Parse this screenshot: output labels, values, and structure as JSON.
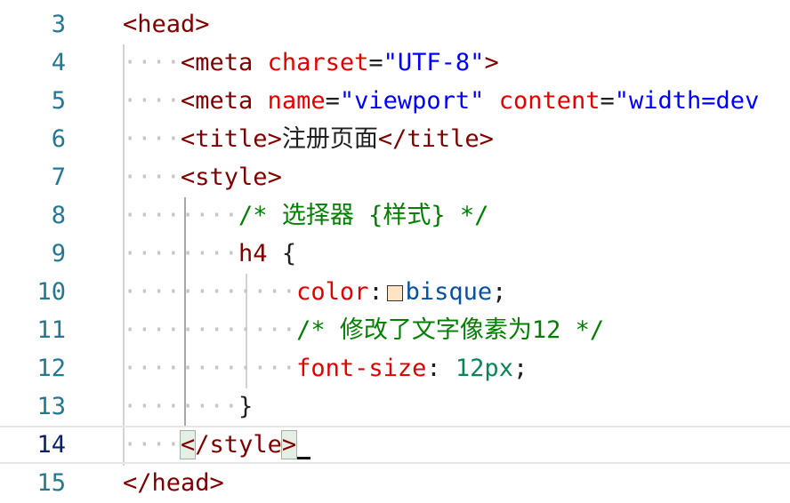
{
  "editor": {
    "lines": [
      {
        "number": "3",
        "indent": "",
        "tokens": [
          {
            "t": "tag",
            "v": "<head>"
          }
        ]
      },
      {
        "number": "4",
        "indent": "····",
        "tokens": [
          {
            "t": "tag",
            "v": "<meta"
          },
          {
            "t": "ws",
            "v": " "
          },
          {
            "t": "attr",
            "v": "charset"
          },
          {
            "t": "punc",
            "v": "="
          },
          {
            "t": "str",
            "v": "\"UTF-8\""
          },
          {
            "t": "tag",
            "v": ">"
          }
        ]
      },
      {
        "number": "5",
        "indent": "····",
        "tokens": [
          {
            "t": "tag",
            "v": "<meta"
          },
          {
            "t": "ws",
            "v": " "
          },
          {
            "t": "attr",
            "v": "name"
          },
          {
            "t": "punc",
            "v": "="
          },
          {
            "t": "str",
            "v": "\"viewport\""
          },
          {
            "t": "ws",
            "v": " "
          },
          {
            "t": "attr",
            "v": "content"
          },
          {
            "t": "punc",
            "v": "="
          },
          {
            "t": "str",
            "v": "\"width=dev"
          }
        ]
      },
      {
        "number": "6",
        "indent": "····",
        "tokens": [
          {
            "t": "tag",
            "v": "<title>"
          },
          {
            "t": "punc",
            "v": "注册页面"
          },
          {
            "t": "tag",
            "v": "</title>"
          }
        ]
      },
      {
        "number": "7",
        "indent": "····",
        "tokens": [
          {
            "t": "tag",
            "v": "<style>"
          }
        ]
      },
      {
        "number": "8",
        "indent": "········",
        "tokens": [
          {
            "t": "cmt",
            "v": "/* 选择器 {样式} */"
          }
        ]
      },
      {
        "number": "9",
        "indent": "········",
        "tokens": [
          {
            "t": "sel",
            "v": "h4"
          },
          {
            "t": "ws",
            "v": " "
          },
          {
            "t": "punc",
            "v": "{"
          }
        ]
      },
      {
        "number": "10",
        "indent": "············",
        "tokens": [
          {
            "t": "prop",
            "v": "color"
          },
          {
            "t": "punc",
            "v": ":"
          },
          {
            "t": "swatch",
            "v": ""
          },
          {
            "t": "val",
            "v": "bisque"
          },
          {
            "t": "punc",
            "v": ";"
          }
        ]
      },
      {
        "number": "11",
        "indent": "············",
        "tokens": [
          {
            "t": "cmt",
            "v": "/* 修改了文字像素为12 */"
          }
        ]
      },
      {
        "number": "12",
        "indent": "············",
        "tokens": [
          {
            "t": "prop",
            "v": "font-size"
          },
          {
            "t": "punc",
            "v": ":"
          },
          {
            "t": "ws",
            "v": " "
          },
          {
            "t": "num",
            "v": "12px"
          },
          {
            "t": "punc",
            "v": ";"
          }
        ]
      },
      {
        "number": "13",
        "indent": "········",
        "tokens": [
          {
            "t": "punc",
            "v": "}"
          }
        ]
      },
      {
        "number": "14",
        "indent": "····",
        "current": true,
        "tokens": [
          {
            "t": "bracket",
            "v": "<"
          },
          {
            "t": "tag",
            "v": "/style"
          },
          {
            "t": "bracket",
            "v": ">"
          },
          {
            "t": "cursor",
            "v": ""
          }
        ]
      },
      {
        "number": "15",
        "indent": "",
        "tokens": [
          {
            "t": "tag",
            "v": "</head>"
          }
        ]
      }
    ],
    "swatch_color": "#ffe4c4"
  }
}
